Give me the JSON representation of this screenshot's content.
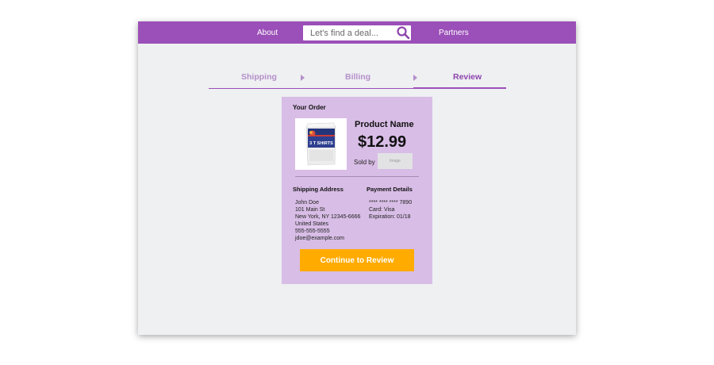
{
  "nav": {
    "about_label": "About",
    "partners_label": "Partners",
    "search_placeholder": "Let's find a deal...",
    "search_icon": "search-icon"
  },
  "steps": [
    {
      "label": "Shipping",
      "active": false
    },
    {
      "label": "Billing",
      "active": false
    },
    {
      "label": "Review",
      "active": true
    }
  ],
  "order": {
    "heading": "Your Order",
    "product_name": "Product Name",
    "price": "$12.99",
    "product_image_text": "3 T SHIRTS",
    "sold_by_label": "Sold by",
    "seller_image_label": "Image"
  },
  "shipping": {
    "title": "Shipping Address",
    "lines": [
      "John Doe",
      "101 Main St",
      "New York, NY 12345-6666",
      "United States",
      "555-555-5555",
      "jdoe@example.com"
    ]
  },
  "payment": {
    "title": "Payment Details",
    "lines": [
      "**** **** **** 7890",
      "Card: Visa",
      "Expiration: 01/18"
    ]
  },
  "actions": {
    "continue_label": "Continue to Review"
  },
  "colors": {
    "brand": "#9b4fb8",
    "card_bg": "#d8bde6",
    "button": "#ffab00",
    "step_inactive": "#b58ec9"
  }
}
